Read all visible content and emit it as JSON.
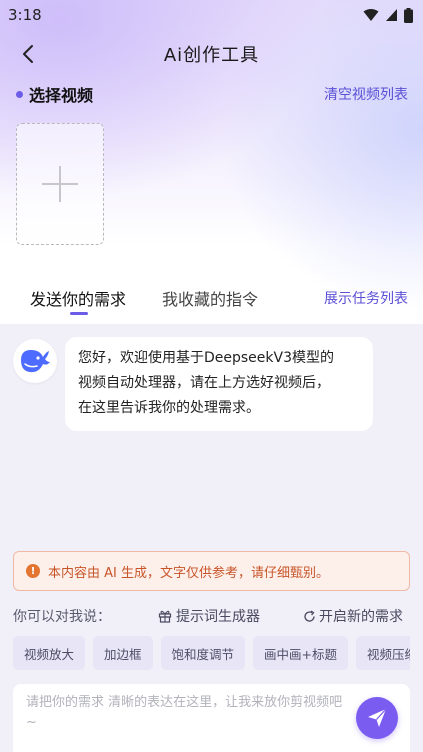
{
  "status_bar": {
    "time": "3:18",
    "icons": [
      "wifi-icon",
      "signal-icon",
      "battery-icon"
    ]
  },
  "header": {
    "title": "Ai创作工具",
    "back_icon": "chevron-left-icon"
  },
  "video_select": {
    "title": "选择视频",
    "clear_link": "清空视频列表",
    "add_icon": "plus-icon"
  },
  "tabs": {
    "items": [
      {
        "label": "发送你的需求",
        "active": true
      },
      {
        "label": "我收藏的指令",
        "active": false
      }
    ],
    "task_link": "展示任务列表"
  },
  "chat": {
    "avatar_icon": "deepseek-whale-icon",
    "messages": [
      {
        "sender": "assistant",
        "lines": [
          "您好，欢迎使用基于DeepseekV3模型的",
          "视频自动处理器，请在上方选好视频后，",
          "在这里告诉我你的处理需求。"
        ]
      }
    ]
  },
  "notice": {
    "icon": "exclamation-icon",
    "text": "本内容由 AI 生成，文字仅供参考，请仔细甄别。"
  },
  "suggestions": {
    "label": "你可以对我说：",
    "prompt_generator": "提示词生成器",
    "prompt_generator_icon": "gift-icon",
    "new_request": "开启新的需求",
    "new_request_icon": "refresh-icon",
    "chips": [
      "视频放大",
      "加边框",
      "饱和度调节",
      "画中画+标题",
      "视频压缩"
    ]
  },
  "input": {
    "placeholder": "请把你的需求 清晰的表达在这里，让我来放你剪视频吧~",
    "send_icon": "send-icon"
  },
  "colors": {
    "accent": "#6c5ce7",
    "link": "#5b4fd6",
    "send_button": "#7b5cf0",
    "notice_text": "#c8552a",
    "notice_bg": "#fdf0ea",
    "chip_bg": "#e7e5f6"
  }
}
